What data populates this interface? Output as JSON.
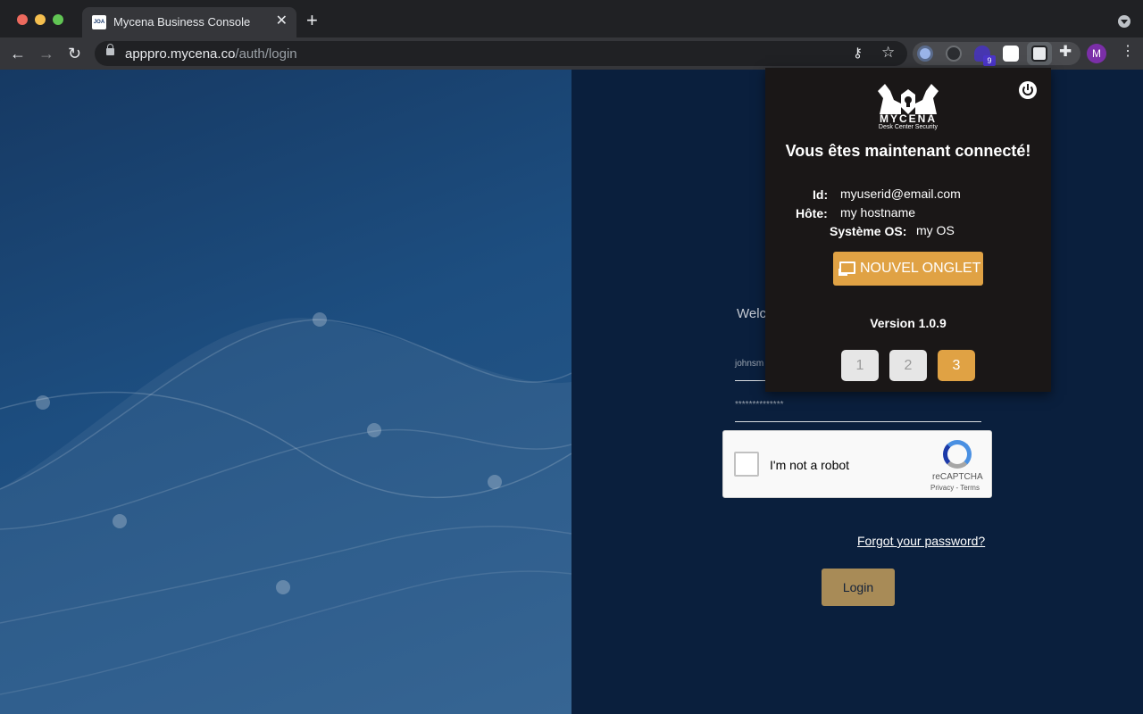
{
  "browser": {
    "tab_title": "Mycena Business Console",
    "tab_favicon_text": "JOA",
    "new_tab_symbol": "+",
    "close_symbol": "✕",
    "url_host": "apppro.mycena.co",
    "url_path": "/auth/login",
    "extension_badge": "9",
    "profile_initial": "M",
    "icons": [
      "back-arrow-icon",
      "forward-arrow-icon",
      "reload-icon",
      "lock-icon",
      "key-icon",
      "star-icon",
      "puzzle-icon",
      "menu-dots-icon"
    ]
  },
  "login": {
    "welcome_text": "Welc",
    "username_value": "johnsm",
    "password_value": "**************",
    "recaptcha_label": "I'm not a robot",
    "recaptcha_brand": "reCAPTCHA",
    "recaptcha_terms": "Privacy - Terms",
    "forgot_password": "Forgot your password?",
    "login_button": "Login"
  },
  "popup": {
    "logo_text": "MYCENA",
    "logo_subtitle": "Desk Center Security",
    "title": "Vous êtes maintenant connecté!",
    "id_label": "Id:",
    "id_value": "myuserid@email.com",
    "host_label": "Hôte:",
    "host_value": "my hostname",
    "os_label": "Système OS:",
    "os_value": "my OS",
    "new_tab_button": "NOUVEL ONGLET",
    "version": "Version 1.0.9",
    "pages": [
      "1",
      "2",
      "3"
    ],
    "active_page": "3"
  },
  "colors": {
    "accent": "#e0a244",
    "login_button": "#a88b57",
    "right_background": "#0a1f3d",
    "left_background": "#1d4e80"
  }
}
